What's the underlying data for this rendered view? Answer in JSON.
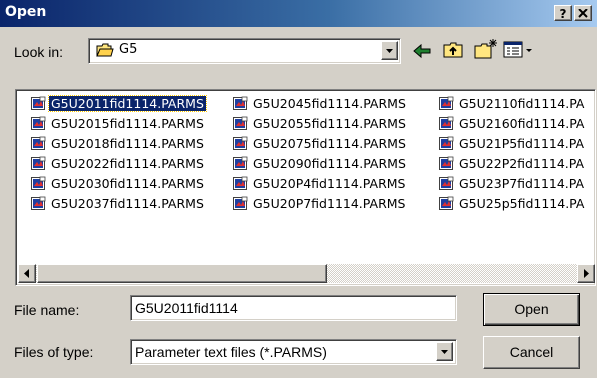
{
  "window": {
    "title": "Open",
    "help_label": "?",
    "close_label": "X"
  },
  "lookin": {
    "label": "Look in:",
    "value": "G5",
    "folder_icon": "folder-icon"
  },
  "toolbar": {
    "icons": [
      "back-arrow-icon",
      "up-folder-icon",
      "new-folder-icon",
      "view-menu-icon"
    ]
  },
  "files": {
    "columns": [
      [
        "G5U2011fid1114.PARMS",
        "G5U2015fid1114.PARMS",
        "G5U2018fid1114.PARMS",
        "G5U2022fid1114.PARMS",
        "G5U2030fid1114.PARMS",
        "G5U2037fid1114.PARMS"
      ],
      [
        "G5U2045fid1114.PARMS",
        "G5U2055fid1114.PARMS",
        "G5U2075fid1114.PARMS",
        "G5U2090fid1114.PARMS",
        "G5U20P4fid1114.PARMS",
        "G5U20P7fid1114.PARMS"
      ],
      [
        "G5U2110fid1114.PA",
        "G5U2160fid1114.PA",
        "G5U21P5fid1114.PA",
        "G5U22P2fid1114.PA",
        "G5U23P7fid1114.PA",
        "G5U25p5fid1114.PA"
      ]
    ],
    "selected": "G5U2011fid1114.PARMS"
  },
  "filename": {
    "label": "File name:",
    "value": "G5U2011fid1114"
  },
  "filetype": {
    "label": "Files of type:",
    "value": "Parameter text files (*.PARMS)"
  },
  "buttons": {
    "open": "Open",
    "cancel": "Cancel"
  },
  "colors": {
    "title_start": "#0a246a",
    "title_end": "#a6caf0",
    "face": "#d4d0c8",
    "selection": "#0a246a"
  }
}
